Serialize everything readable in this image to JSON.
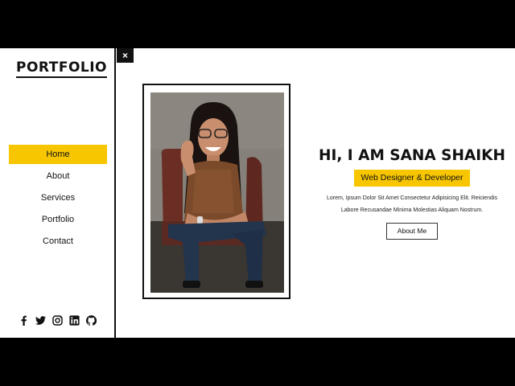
{
  "sidebar": {
    "logo": "PORTFOLIO",
    "nav": [
      {
        "label": "Home",
        "active": true
      },
      {
        "label": "About",
        "active": false
      },
      {
        "label": "Services",
        "active": false
      },
      {
        "label": "Portfolio",
        "active": false
      },
      {
        "label": "Contact",
        "active": false
      }
    ],
    "socials": [
      "facebook-icon",
      "twitter-icon",
      "instagram-icon",
      "linkedin-icon",
      "github-icon"
    ]
  },
  "close_toggle": "×",
  "hero": {
    "title": "HI, I AM SANA SHAIKH",
    "role": "Web Designer & Developer",
    "description_line1": "Lorem, Ipsum Dolor Sit Amet Consectetur Adipisicing Elit. Reiciendis",
    "description_line2": "Labore Recusandae Minima Molestias Aliquam Nostrum.",
    "button": "About Me"
  },
  "colors": {
    "accent": "#f7c600",
    "text": "#111111",
    "background": "#ffffff",
    "letterbox": "#000000"
  }
}
